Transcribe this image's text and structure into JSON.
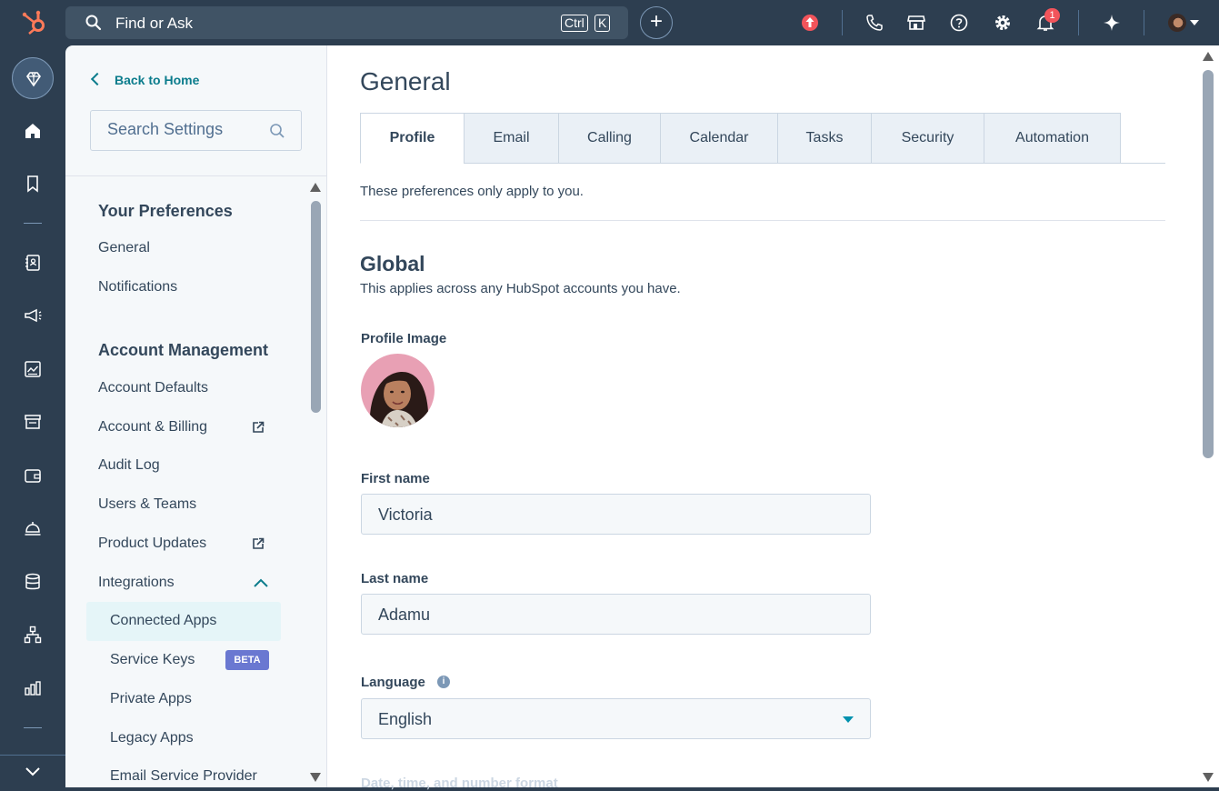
{
  "topbar": {
    "search_label": "Find or Ask",
    "shortcut_key1": "Ctrl",
    "shortcut_key2": "K",
    "add_symbol": "+",
    "notification_count": "1"
  },
  "sidebar": {
    "back_label": "Back to Home",
    "search_placeholder": "Search Settings",
    "section1": {
      "title": "Your Preferences",
      "items": [
        "General",
        "Notifications"
      ]
    },
    "section2": {
      "title": "Account Management",
      "items": [
        "Account Defaults",
        "Account & Billing",
        "Audit Log",
        "Users & Teams",
        "Product Updates",
        "Integrations"
      ]
    },
    "integrations_sub": [
      "Connected Apps",
      "Service Keys",
      "Private Apps",
      "Legacy Apps",
      "Email Service Provider"
    ],
    "beta_badge": "BETA"
  },
  "main": {
    "title": "General",
    "tabs": [
      "Profile",
      "Email",
      "Calling",
      "Calendar",
      "Tasks",
      "Security",
      "Automation"
    ],
    "active_tab": "Profile",
    "note": "These preferences only apply to you.",
    "global_title": "Global",
    "global_sub": "This applies across any HubSpot accounts you have.",
    "profile_image_label": "Profile Image",
    "first_name_label": "First name",
    "first_name_value": "Victoria",
    "last_name_label": "Last name",
    "last_name_value": "Adamu",
    "language_label": "Language",
    "language_value": "English",
    "next_label": "Date, time, and number format"
  },
  "colors": {
    "nav_bg": "#2d3e50",
    "accent_teal": "#0b7c8c",
    "hubspot_orange": "#ff7a59",
    "beta_purple": "#6a78d1"
  }
}
